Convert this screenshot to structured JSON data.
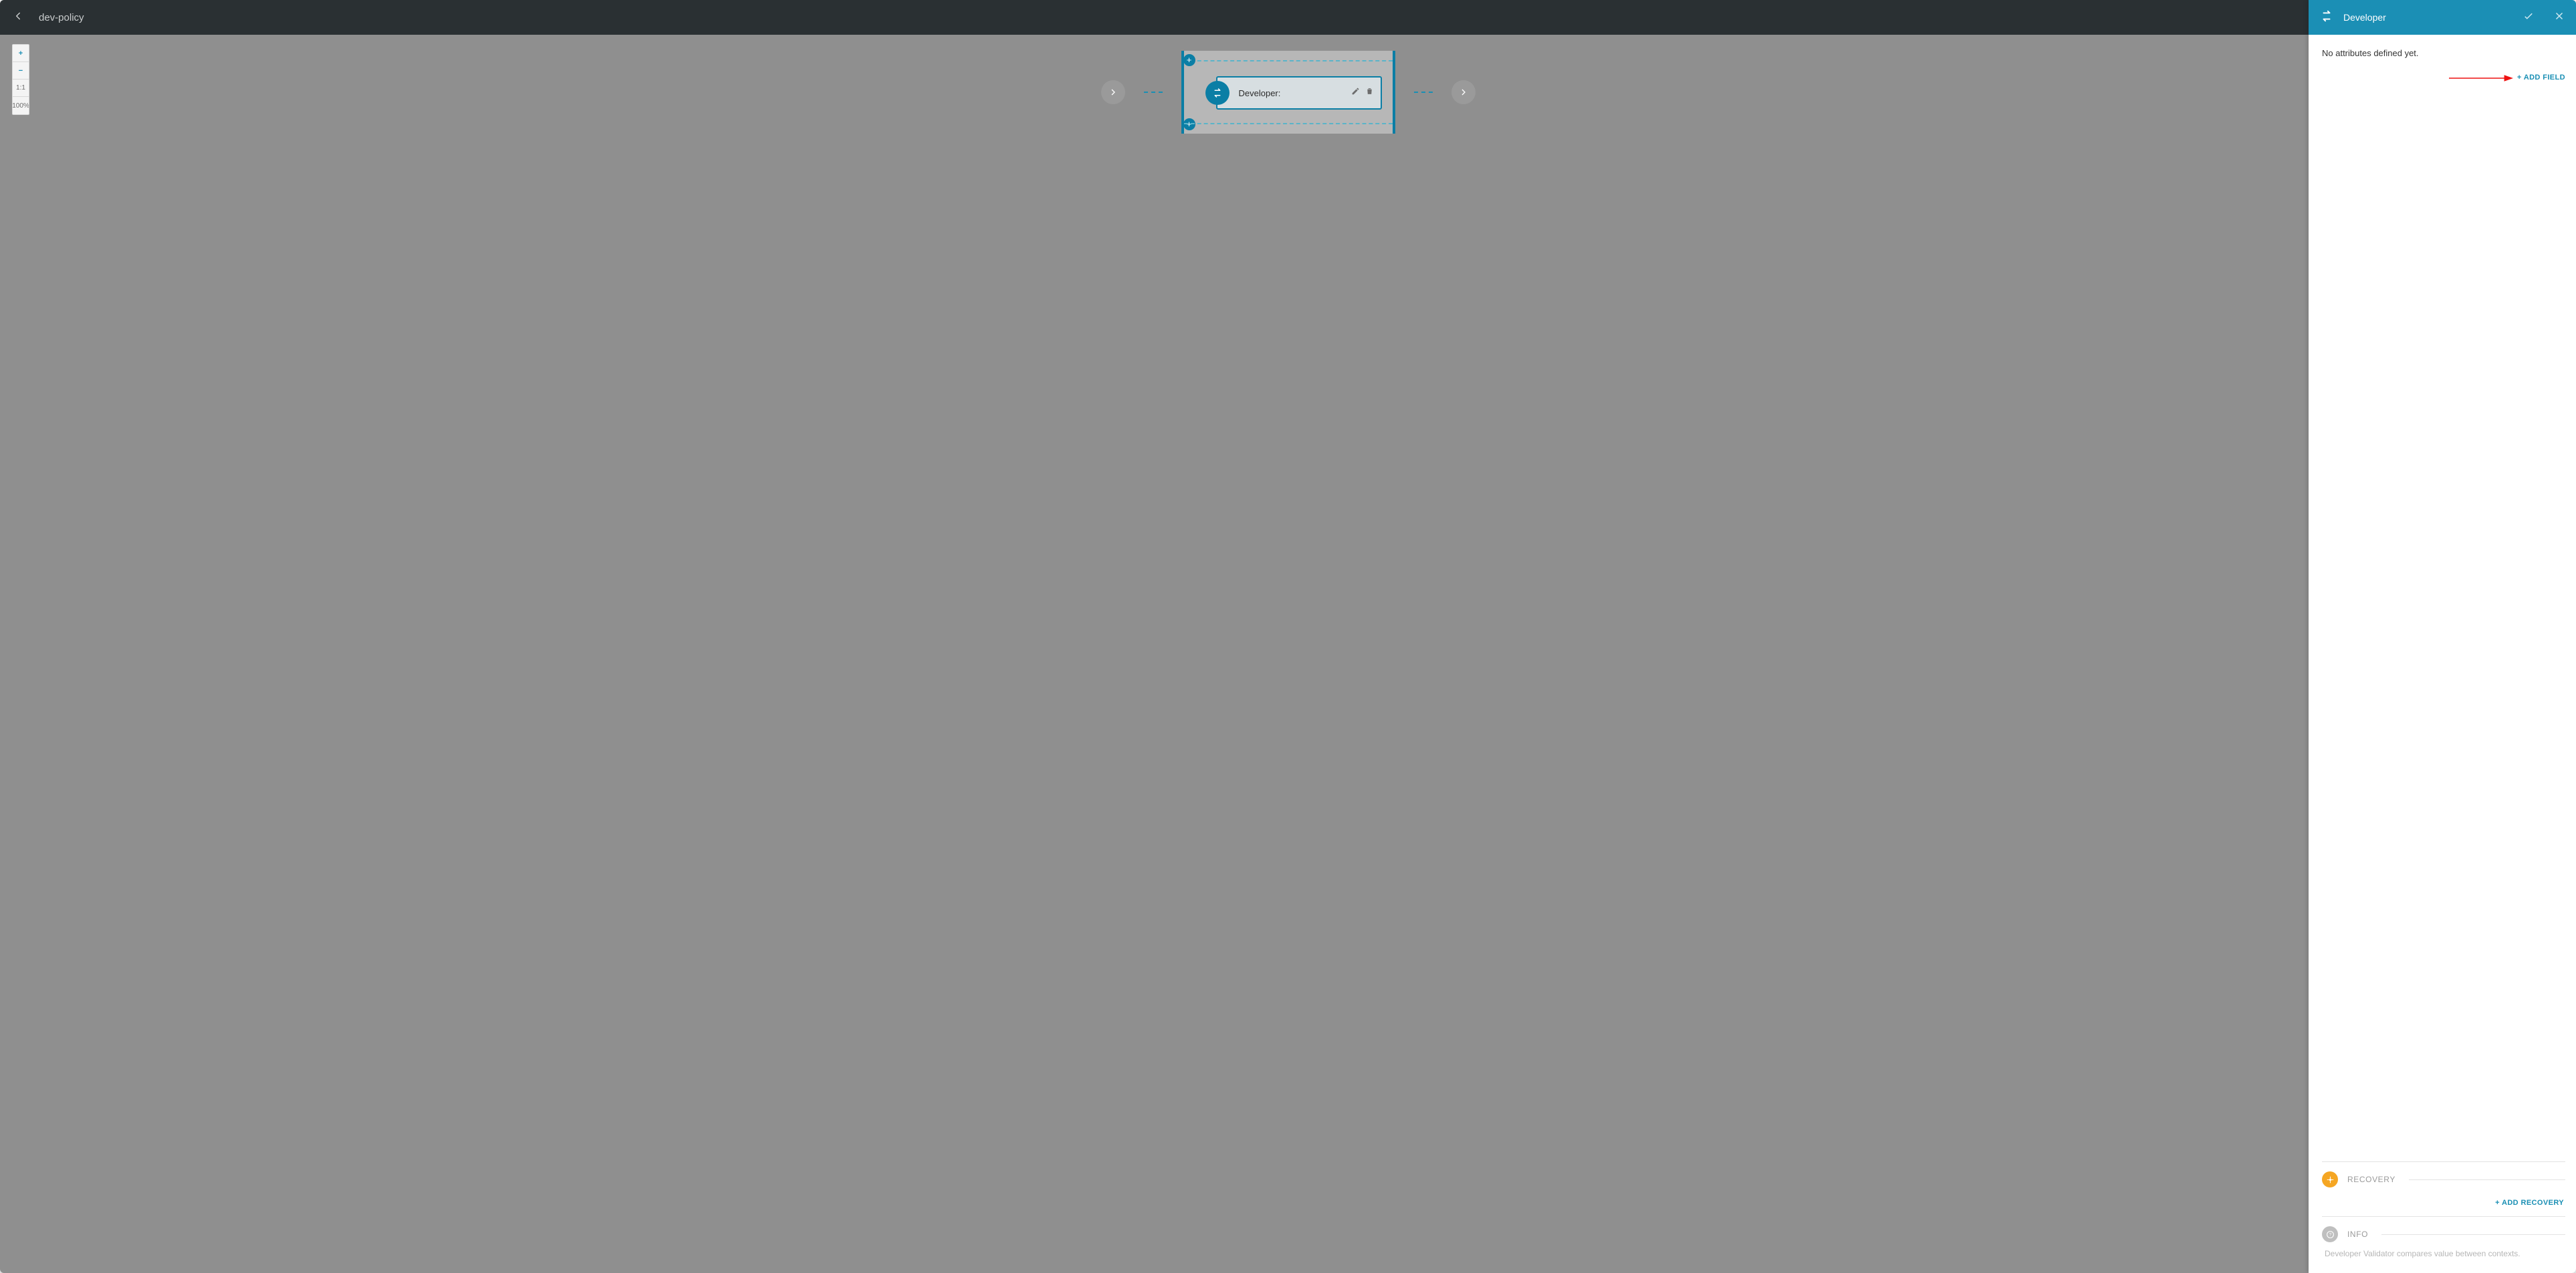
{
  "topbar": {
    "title": "dev-policy"
  },
  "zoom": {
    "plus": "+",
    "minus": "−",
    "fit": "1:1",
    "percent": "100%"
  },
  "node": {
    "label": "Developer:"
  },
  "panel": {
    "title": "Developer",
    "empty": "No attributes defined yet.",
    "add_field": "+ ADD FIELD",
    "recovery": {
      "label": "RECOVERY",
      "add": "+ ADD RECOVERY"
    },
    "info": {
      "label": "INFO",
      "text": "Developer Validator compares value between contexts."
    }
  }
}
